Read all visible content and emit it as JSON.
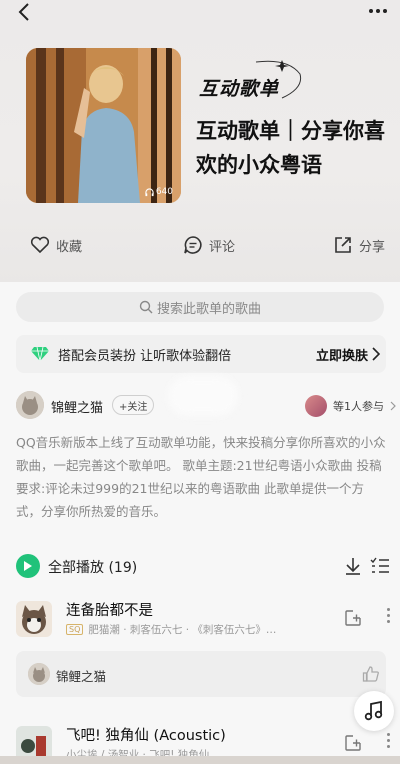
{
  "hero": {
    "play_count": "640",
    "brand_text": "互动歌单",
    "title": "互动歌单｜分享你喜欢的小众粤语"
  },
  "actions": {
    "favorite_label": "收藏",
    "comment_label": "评论",
    "share_label": "分享"
  },
  "search": {
    "placeholder": "搜索此歌单的歌曲"
  },
  "vip_banner": {
    "text": "搭配会员装扮 让听歌体验翻倍",
    "cta": "立即换肤"
  },
  "creator": {
    "name": "锦鲤之猫",
    "follow_label": "+关注",
    "participants": "等1人参与"
  },
  "description": "QQ音乐新版本上线了互动歌单功能，快来投稿分享你所喜欢的小众歌曲，一起完善这个歌单吧。 歌单主题:21世纪粤语小众歌曲 投稿要求:评论未过999的21世纪以来的粤语歌曲 此歌单提供一个方式，分享你所热爱的音乐。",
  "play_all": {
    "label": "全部播放",
    "count": "(19)"
  },
  "songs": [
    {
      "title": "连备胎都不是",
      "badge": "SQ",
      "meta": "肥猫潮 · 刺客伍六七 · 《刺客伍六七》…"
    },
    {
      "title": "飞吧! 独角仙 (Acoustic)",
      "badge": "",
      "meta": "小尘埃 / 汤智业 · 飞吧! 独角仙"
    }
  ],
  "contributor": {
    "name": "锦鲤之猫"
  },
  "colors": {
    "accent_green": "#20c27a",
    "vip_gold": "#c9a25a"
  }
}
